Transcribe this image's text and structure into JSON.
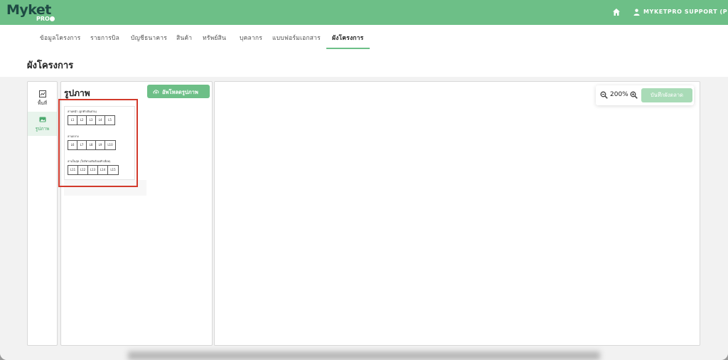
{
  "app": {
    "logo_text": "Myket",
    "logo_sub": "PRO"
  },
  "header": {
    "home_icon": "home-icon",
    "user_icon": "user-icon",
    "user_name": "MYKETPRO SUPPORT (P)"
  },
  "tabs": [
    {
      "label": "ข้อมูลโครงการ"
    },
    {
      "label": "รายการบิล"
    },
    {
      "label": "บัญชีธนาคาร"
    },
    {
      "label": "สินค้า"
    },
    {
      "label": "ทรัพย์สิน"
    },
    {
      "label": "บุคลากร"
    },
    {
      "label": "แบบฟอร์มเอกสาร"
    },
    {
      "label": "ผังโครงการ",
      "active": true
    }
  ],
  "page": {
    "title": "ผังโครงการ"
  },
  "sidebar": {
    "items": [
      {
        "label": "พื้นที่",
        "icon": "area-chart-icon"
      },
      {
        "label": "รูปภาพ",
        "icon": "image-icon",
        "active": true
      }
    ]
  },
  "images_panel": {
    "title": "รูปภาพ",
    "upload_label": "อัพโหลดรูปภาพ",
    "upload_icon": "cloud-upload-icon",
    "thumbnail": {
      "zones": [
        {
          "label": "ลานหน้า (ลูกค้าเดินผ่าน)",
          "slots": [
            "L1",
            "L2",
            "L3",
            "L4",
            "L5"
          ]
        },
        {
          "label": "ลานกลาง",
          "slots": [
            "L6",
            "L7",
            "L8",
            "L9",
            "L10"
          ]
        },
        {
          "label": "ลานในสุด (ใกล้ทางเดินร้องเท้าเพื่อห)",
          "slots": [
            "L11",
            "L12",
            "L13",
            "L14",
            "L15"
          ]
        }
      ]
    }
  },
  "canvas": {
    "zoom_level": "200%",
    "zoom_out_icon": "zoom-out-icon",
    "zoom_in_icon": "zoom-in-icon",
    "save_label": "บันทึกผังตลาด"
  },
  "colors": {
    "brand": "#6dbf87",
    "logo": "#1f4b44",
    "highlight": "#d23a2c",
    "save_disabled": "#a9dbb7"
  }
}
